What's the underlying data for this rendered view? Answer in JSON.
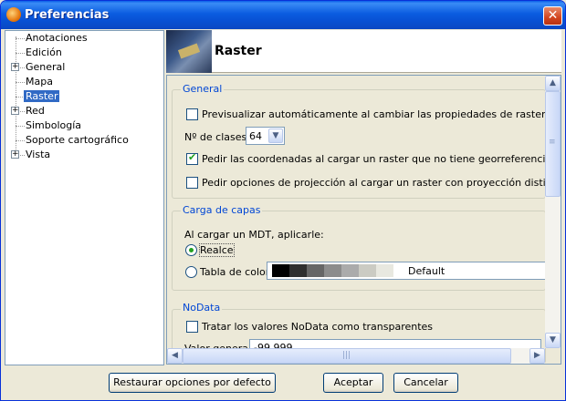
{
  "window": {
    "title": "Preferencias",
    "close": "✕"
  },
  "tree": [
    {
      "label": "Anotaciones",
      "expandable": false
    },
    {
      "label": "Edición",
      "expandable": false
    },
    {
      "label": "General",
      "expandable": true
    },
    {
      "label": "Mapa",
      "expandable": false
    },
    {
      "label": "Raster",
      "expandable": false,
      "selected": true
    },
    {
      "label": "Red",
      "expandable": true
    },
    {
      "label": "Simbología",
      "expandable": false
    },
    {
      "label": "Soporte cartográfico",
      "expandable": false
    },
    {
      "label": "Vista",
      "expandable": true
    }
  ],
  "header": {
    "title": "Raster"
  },
  "general": {
    "title": "General",
    "preview_label": "Previsualizar automáticamente al cambiar las propiedades de raster",
    "preview_checked": false,
    "classes_label": "Nº de clases:",
    "classes_value": "64",
    "coords_label": "Pedir las coordenadas al cargar un raster que no tiene georreferenciación",
    "coords_checked": true,
    "projection_label": "Pedir opciones de projección al cargar un raster con proyección distinta a la vis",
    "projection_checked": false
  },
  "carga": {
    "title": "Carga de capas",
    "mdt_label": "Al cargar un MDT, aplicarle:",
    "realce_label": "Realce",
    "tabla_label": "Tabla de color",
    "selected": "realce",
    "ramp_name": "Default",
    "ramp_colors": [
      "#000000",
      "#2f2f2f",
      "#666666",
      "#8c8c8c",
      "#ababab",
      "#cbcbc3",
      "#e8e8e0"
    ]
  },
  "nodata": {
    "title": "NoData",
    "transparent_label": "Tratar los valores NoData como transparentes",
    "transparent_checked": false,
    "general_label": "Valor general:",
    "general_value": "-99 999"
  },
  "icons": {
    "scroll_up": "▲",
    "scroll_down": "▼",
    "scroll_left": "◀",
    "scroll_right": "▶",
    "combo_down": "▼",
    "grip_v": "≡",
    "grip_h": "|||",
    "expander": "+"
  },
  "buttons": {
    "restore": "Restaurar opciones por defecto",
    "accept": "Aceptar",
    "cancel": "Cancelar"
  }
}
